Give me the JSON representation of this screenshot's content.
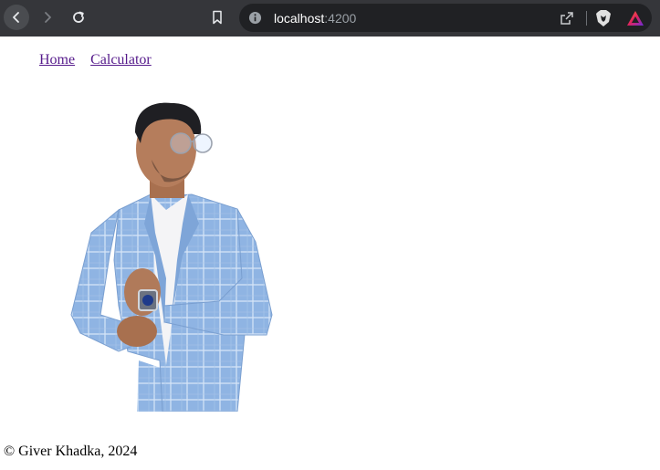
{
  "browser": {
    "url_host": "localhost",
    "url_port": ":4200"
  },
  "nav": {
    "home_label": "Home",
    "calculator_label": "Calculator"
  },
  "main": {
    "photo_icon": "portrait-photo"
  },
  "footer": {
    "text": "© Giver Khadka, 2024"
  },
  "colors": {
    "chrome_bg": "#35363a",
    "omnibox_bg": "#202124",
    "link_visited": "#551a8b",
    "suit_blue": "#8fb4e3"
  }
}
